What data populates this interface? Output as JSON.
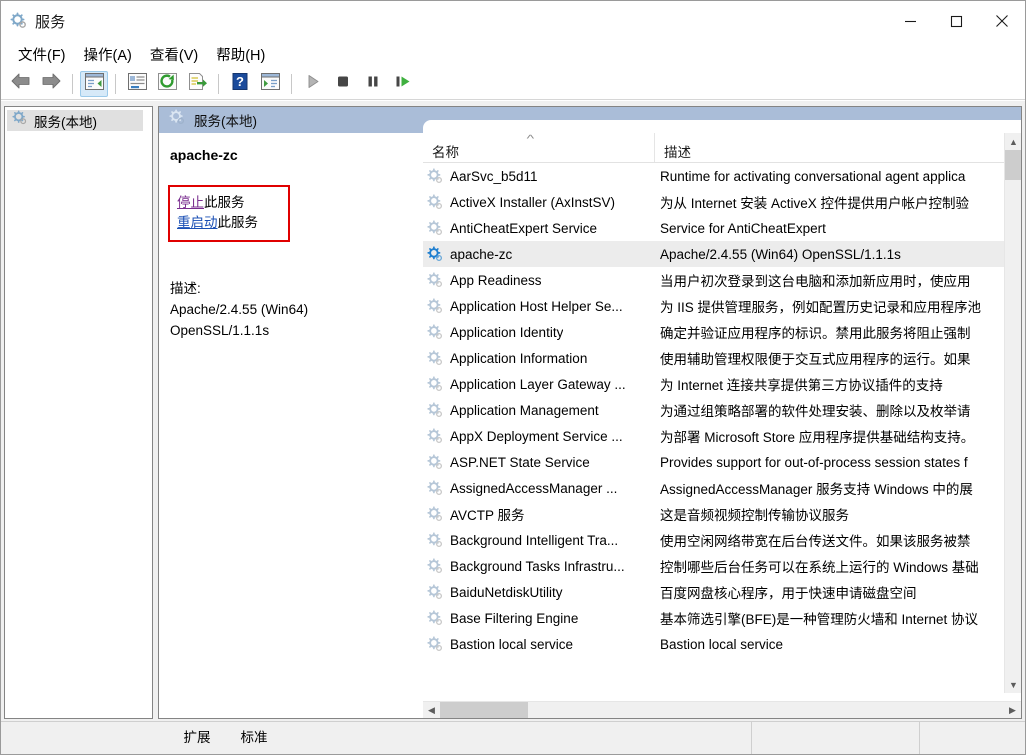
{
  "window": {
    "title": "服务",
    "icon": "services-gear-icon",
    "minimize_label": "最小化",
    "maximize_label": "最大化",
    "close_label": "关闭"
  },
  "menubar": {
    "items": [
      {
        "label": "文件(F)",
        "name": "menu-file"
      },
      {
        "label": "操作(A)",
        "name": "menu-action"
      },
      {
        "label": "查看(V)",
        "name": "menu-view"
      },
      {
        "label": "帮助(H)",
        "name": "menu-help"
      }
    ]
  },
  "toolbar": {
    "buttons": [
      {
        "icon": "back-arrow-icon",
        "name": "toolbar-back"
      },
      {
        "icon": "forward-arrow-icon",
        "name": "toolbar-forward"
      },
      {
        "icon": "show-hide-tree-icon",
        "name": "toolbar-show-hide-console-tree",
        "active": true
      },
      {
        "icon": "properties-icon",
        "name": "toolbar-properties"
      },
      {
        "icon": "refresh-icon",
        "name": "toolbar-refresh"
      },
      {
        "icon": "export-list-icon",
        "name": "toolbar-export-list"
      },
      {
        "icon": "help-icon",
        "name": "toolbar-help"
      },
      {
        "icon": "show-action-pane-icon",
        "name": "toolbar-show-action-pane"
      },
      {
        "icon": "play-icon",
        "name": "toolbar-start-service"
      },
      {
        "icon": "stop-icon",
        "name": "toolbar-stop-service"
      },
      {
        "icon": "pause-icon",
        "name": "toolbar-pause-service"
      },
      {
        "icon": "restart-icon",
        "name": "toolbar-restart-service"
      }
    ]
  },
  "tree": {
    "root": {
      "label": "服务(本地)",
      "icon": "services-gear-icon"
    }
  },
  "view": {
    "header_label": "服务(本地)",
    "header_icon": "services-gear-icon"
  },
  "detail": {
    "service_name": "apache-zc",
    "stop_link": "停止",
    "stop_suffix": "此服务",
    "restart_link": "重启动",
    "restart_suffix": "此服务",
    "description_label": "描述:",
    "description_line1": "Apache/2.4.55 (Win64)",
    "description_line2": "OpenSSL/1.1.1s"
  },
  "list": {
    "columns": [
      {
        "label": "名称",
        "name": "column-header-name",
        "sort": "asc"
      },
      {
        "label": "描述",
        "name": "column-header-description"
      }
    ],
    "rows": [
      {
        "name": "AarSvc_b5d11",
        "desc": "Runtime for activating conversational agent applica",
        "running": false,
        "selected": false
      },
      {
        "name": "ActiveX Installer (AxInstSV)",
        "desc": "为从 Internet 安装 ActiveX 控件提供用户帐户控制验",
        "running": false,
        "selected": false
      },
      {
        "name": "AntiCheatExpert Service",
        "desc": "Service for AntiCheatExpert",
        "running": false,
        "selected": false
      },
      {
        "name": "apache-zc",
        "desc": "Apache/2.4.55 (Win64) OpenSSL/1.1.1s",
        "running": true,
        "selected": true
      },
      {
        "name": "App Readiness",
        "desc": "当用户初次登录到这台电脑和添加新应用时，使应用",
        "running": false,
        "selected": false
      },
      {
        "name": "Application Host Helper Se...",
        "desc": "为 IIS 提供管理服务，例如配置历史记录和应用程序池",
        "running": false,
        "selected": false
      },
      {
        "name": "Application Identity",
        "desc": "确定并验证应用程序的标识。禁用此服务将阻止强制",
        "running": false,
        "selected": false
      },
      {
        "name": "Application Information",
        "desc": "使用辅助管理权限便于交互式应用程序的运行。如果",
        "running": false,
        "selected": false
      },
      {
        "name": "Application Layer Gateway ...",
        "desc": "为 Internet 连接共享提供第三方协议插件的支持",
        "running": false,
        "selected": false
      },
      {
        "name": "Application Management",
        "desc": "为通过组策略部署的软件处理安装、删除以及枚举请",
        "running": false,
        "selected": false
      },
      {
        "name": "AppX Deployment Service ...",
        "desc": "为部署 Microsoft Store 应用程序提供基础结构支持。",
        "running": false,
        "selected": false
      },
      {
        "name": "ASP.NET State Service",
        "desc": "Provides support for out-of-process session states f",
        "running": false,
        "selected": false
      },
      {
        "name": "AssignedAccessManager ...",
        "desc": "AssignedAccessManager 服务支持 Windows 中的展",
        "running": false,
        "selected": false
      },
      {
        "name": "AVCTP 服务",
        "desc": "这是音频视频控制传输协议服务",
        "running": false,
        "selected": false
      },
      {
        "name": "Background Intelligent Tra...",
        "desc": "使用空闲网络带宽在后台传送文件。如果该服务被禁",
        "running": false,
        "selected": false
      },
      {
        "name": "Background Tasks Infrastru...",
        "desc": "控制哪些后台任务可以在系统上运行的 Windows 基础",
        "running": false,
        "selected": false
      },
      {
        "name": "BaiduNetdiskUtility",
        "desc": "百度网盘核心程序，用于快速申请磁盘空间",
        "running": false,
        "selected": false
      },
      {
        "name": "Base Filtering Engine",
        "desc": "基本筛选引擎(BFE)是一种管理防火墙和 Internet 协议",
        "running": false,
        "selected": false
      },
      {
        "name": "Bastion local service",
        "desc": "Bastion local service",
        "running": false,
        "selected": false
      }
    ]
  },
  "tabs": [
    {
      "label": "扩展",
      "name": "tab-extended",
      "active": false
    },
    {
      "label": "标准",
      "name": "tab-standard",
      "active": true
    }
  ],
  "colors": {
    "header_bg": "#aabdd8",
    "selection": "#ececec",
    "link_visited": "#7a2d8f",
    "link_normal": "#1a4fb5",
    "highlight_box": "#e00000",
    "toolbar_active": "#d6e9f8"
  }
}
